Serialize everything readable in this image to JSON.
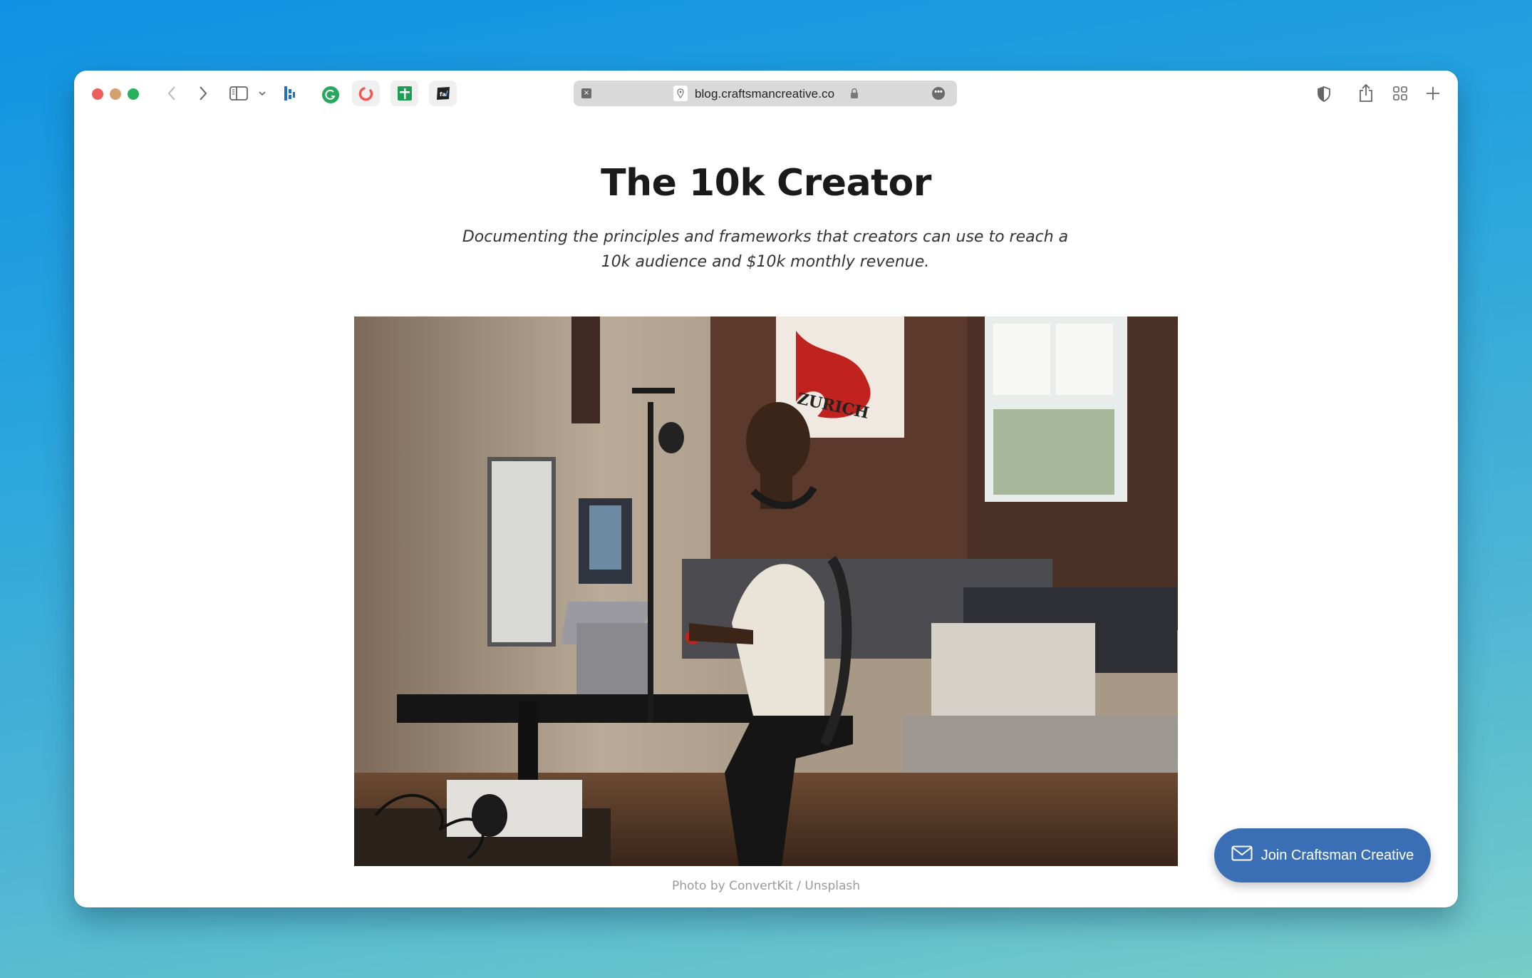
{
  "browser": {
    "url": "blog.craftsmancreative.co",
    "traffic_lights": [
      "close",
      "minimize",
      "zoom"
    ],
    "toolbar_left_icons": [
      "back-icon",
      "forward-icon",
      "sidebar-icon",
      "chevron-down-icon"
    ],
    "extensions": [
      {
        "name": "dashlane-extension-icon",
        "color": "#1f6fc4"
      },
      {
        "name": "grammarly-extension-icon",
        "color": "#27a85d"
      },
      {
        "name": "convertkit-extension-icon",
        "color": "#f05a50"
      },
      {
        "name": "google-sheets-extension-icon",
        "color": "#1f9d55"
      },
      {
        "name": "fa-extension-icon",
        "label": "fa/",
        "color": "#222222"
      }
    ],
    "url_more_label": "•••",
    "url_clear_label": "×",
    "toolbar_right_icons": [
      "privacy-shield-icon",
      "share-icon",
      "tab-overview-icon",
      "new-tab-icon"
    ],
    "new_tab_label": "+"
  },
  "page": {
    "title": "The 10k Creator",
    "subtitle": "Documenting the principles and frameworks that creators can use to reach a 10k audience and $10k monthly revenue.",
    "hero_image_alt": "Man at a desk with monitors, laptops and a podcast microphone in a brick-walled loft",
    "caption": "Photo by ConvertKit / Unsplash",
    "cta_label": "Join Craftsman Creative"
  },
  "colors": {
    "cta": "#3b6fb5",
    "title": "#1a1a1a",
    "caption": "#9a9a9a"
  }
}
